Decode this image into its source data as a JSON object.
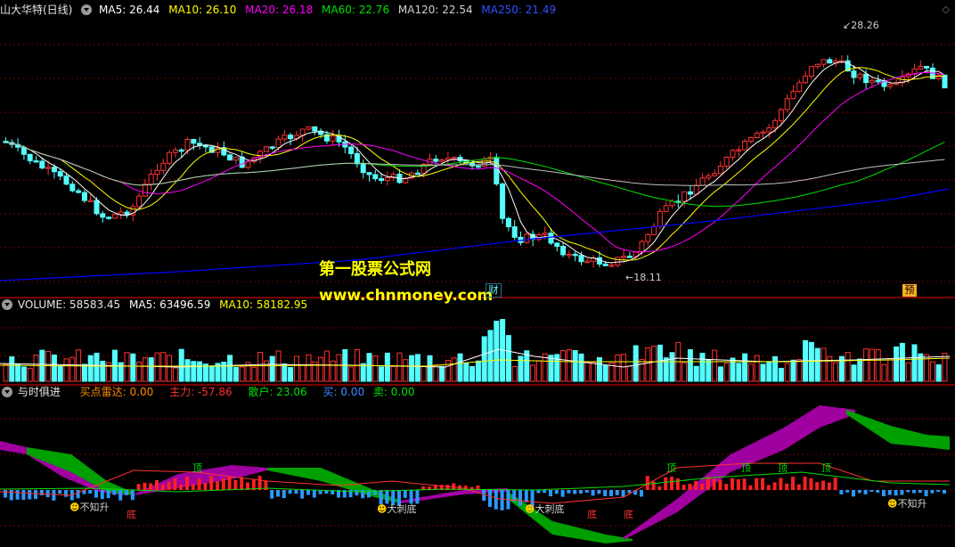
{
  "main_header": {
    "stock": "山大华特(日线)",
    "ma5": "MA5: 26.44",
    "ma10": "MA10: 26.10",
    "ma20": "MA20: 26.18",
    "ma60": "MA60: 22.76",
    "ma120": "MA120: 22.54",
    "ma250": "MA250: 21.49"
  },
  "vol_header": {
    "volume": "VOLUME: 58583.45",
    "ma5": "MA5: 63496.59",
    "ma10": "MA10: 58182.95"
  },
  "ind_header": {
    "name": "与时俱进",
    "radar": "买点雷达: 0.00",
    "zhuli": "主力: -57.86",
    "sanhu": "散户: 23.06",
    "mai": "买: 0.00",
    "mai2": "卖: 0.00"
  },
  "price_annotations": {
    "high": "28.26",
    "low": "18.11"
  },
  "watermark": {
    "line1": "第一股票公式网",
    "line2": "www.chnmoney.com"
  },
  "badges": {
    "cai": "财",
    "yu": "预"
  },
  "signals": {
    "ding": "顶",
    "di": "底",
    "buzhi": "不知升",
    "dadi": "大刺底"
  },
  "colors": {
    "up": "#ff3232",
    "down": "#54ffff",
    "ma5": "#ffffff",
    "ma10": "#ffff00",
    "ma20": "#ff00ff",
    "ma60": "#00e000",
    "ma120": "#c0c0c0",
    "ma250": "#0000ff",
    "grid": "#7a0000",
    "ribbon_purple": "#a000a0",
    "ribbon_green": "#00a000"
  }
}
